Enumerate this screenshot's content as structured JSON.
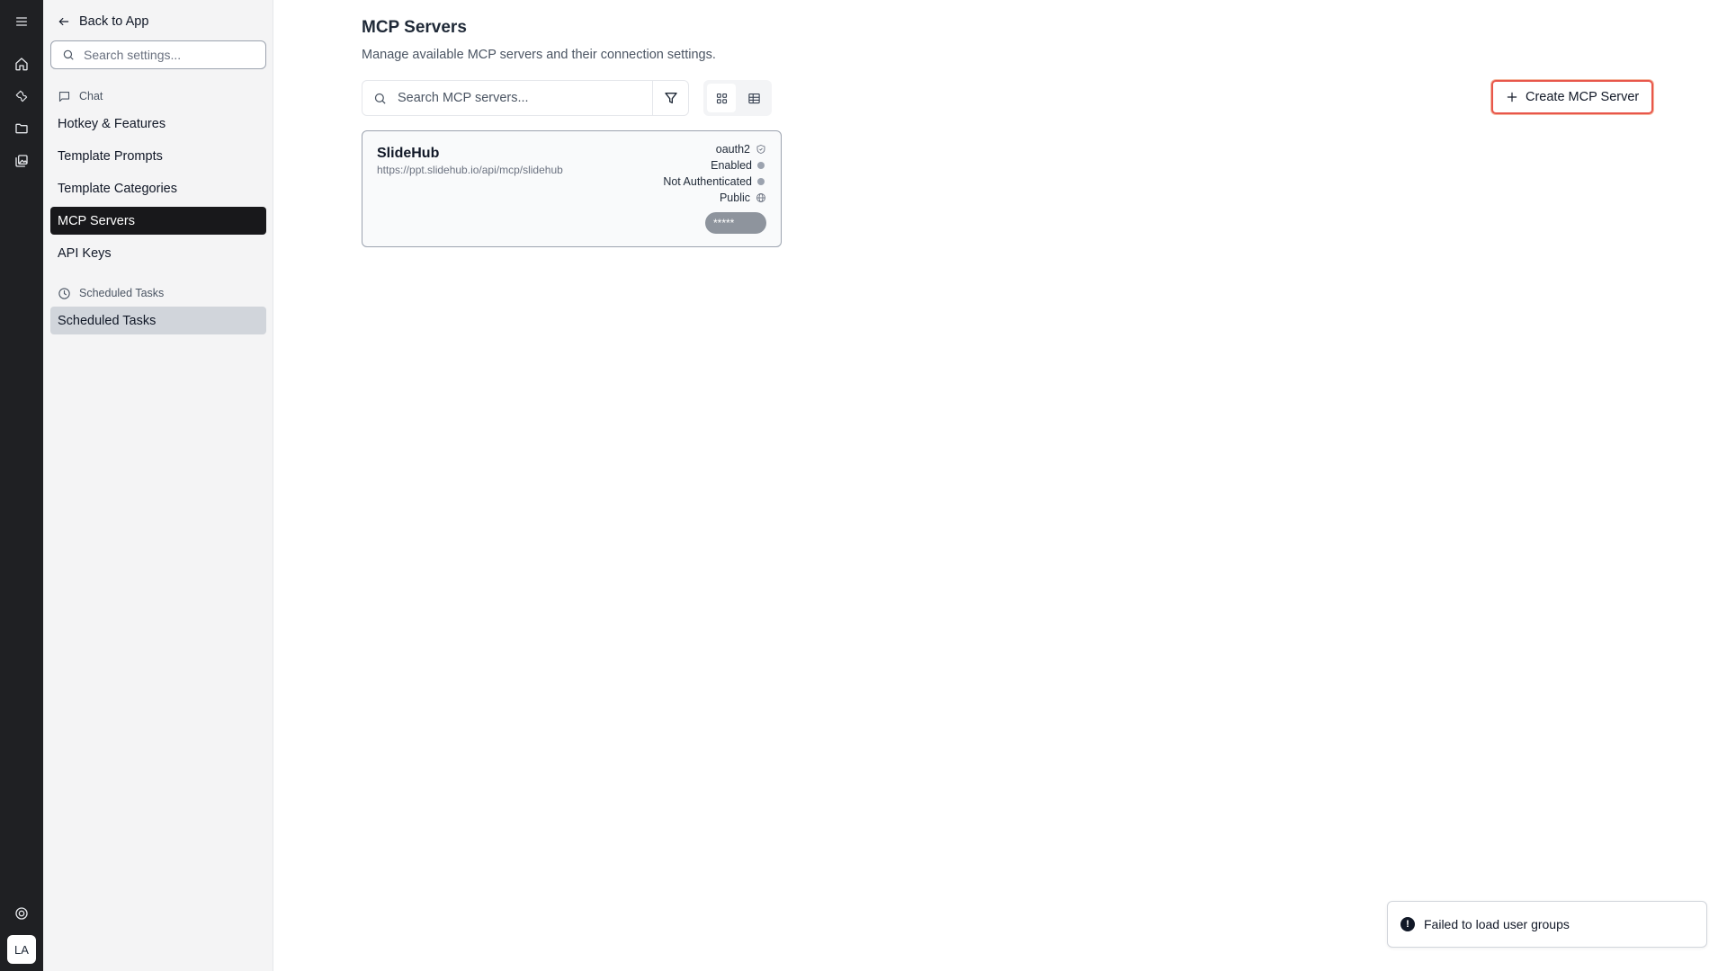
{
  "rail": {
    "menu_icon": "menu-icon",
    "items": [
      "home-icon",
      "wrench-icon",
      "folder-icon",
      "images-icon"
    ],
    "help_icon": "help-icon",
    "avatar_initials": "LA"
  },
  "sidebar": {
    "back_label": "Back to App",
    "search_placeholder": "Search settings...",
    "sections": [
      {
        "title": "Chat",
        "icon": "chat-icon",
        "items": [
          {
            "label": "Hotkey & Features",
            "state": "default"
          },
          {
            "label": "Template Prompts",
            "state": "default"
          },
          {
            "label": "Template Categories",
            "state": "default"
          },
          {
            "label": "MCP Servers",
            "state": "active"
          },
          {
            "label": "API Keys",
            "state": "default"
          }
        ]
      },
      {
        "title": "Scheduled Tasks",
        "icon": "clock-icon",
        "items": [
          {
            "label": "Scheduled Tasks",
            "state": "highlight"
          }
        ]
      }
    ]
  },
  "main": {
    "title": "MCP Servers",
    "description": "Manage available MCP servers and their connection settings.",
    "search_placeholder": "Search MCP servers...",
    "view_mode": "grid",
    "create_label": "Create MCP Server"
  },
  "servers": [
    {
      "name": "SlideHub",
      "url": "https://ppt.slidehub.io/api/mcp/slidehub",
      "auth": "oauth2",
      "status": "Enabled",
      "auth_state": "Not Authenticated",
      "visibility": "Public",
      "secret": "*****"
    }
  ],
  "toast": {
    "message": "Failed to load user groups"
  },
  "colors": {
    "rail_bg": "#1f2023",
    "active_nav": "#18181b",
    "create_border": "#e8564b"
  }
}
